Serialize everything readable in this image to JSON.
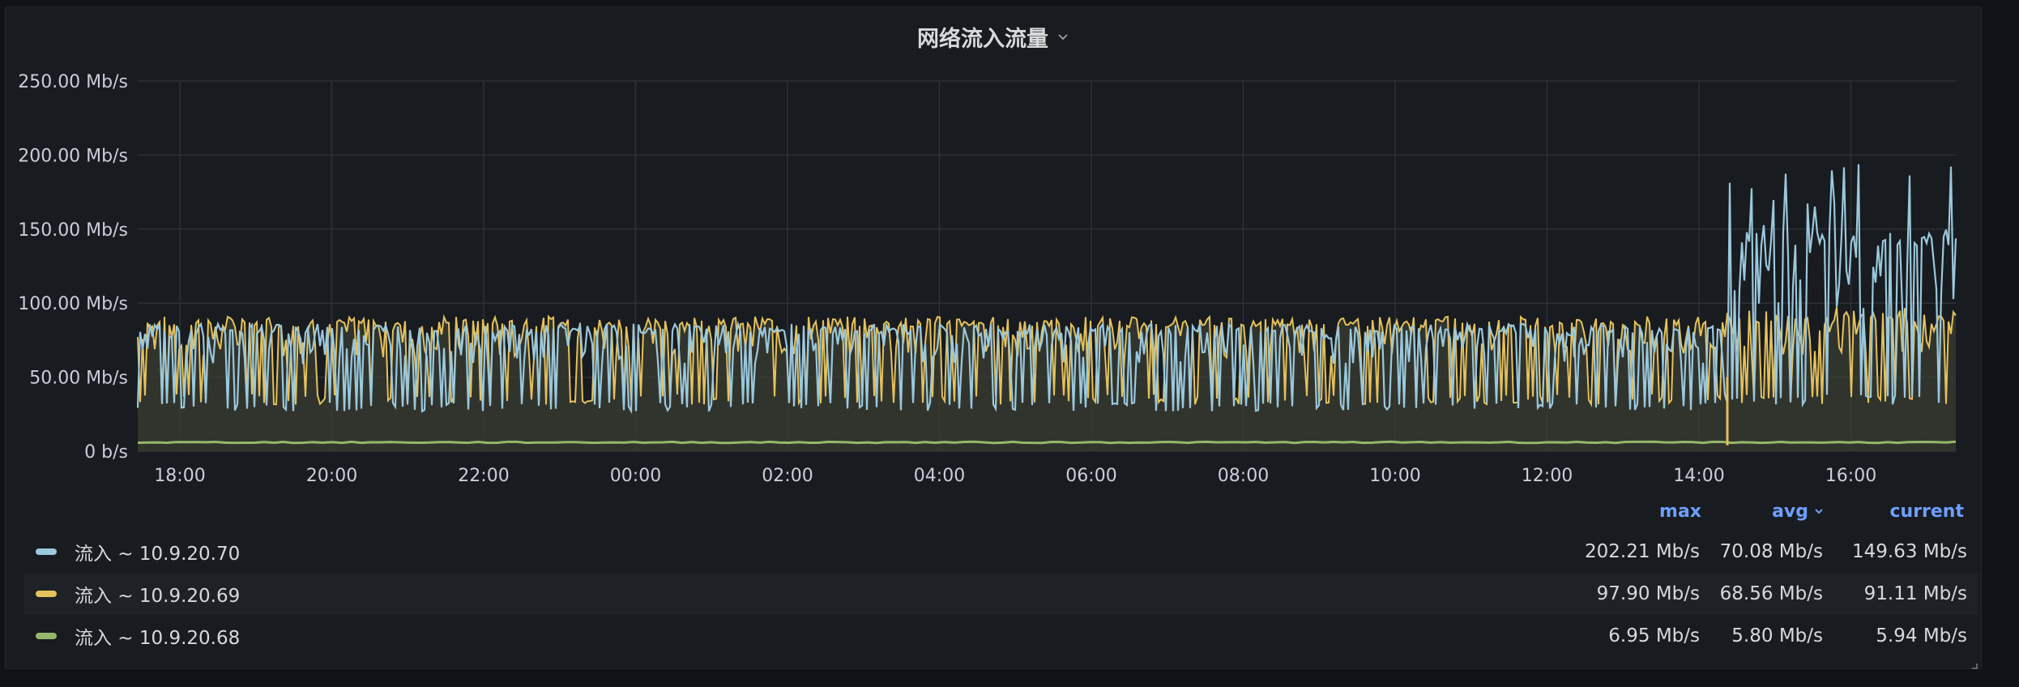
{
  "panel": {
    "title": "网络流入流量"
  },
  "chart_data": {
    "type": "line",
    "title": "网络流入流量",
    "ylabel": "",
    "xlabel": "",
    "ylim": [
      0,
      250
    ],
    "y_unit": "Mb/s",
    "y_ticks": [
      "0 b/s",
      "50.00 Mb/s",
      "100.00 Mb/s",
      "150.00 Mb/s",
      "200.00 Mb/s",
      "250.00 Mb/s"
    ],
    "x_ticks": [
      "18:00",
      "20:00",
      "22:00",
      "00:00",
      "02:00",
      "04:00",
      "06:00",
      "08:00",
      "10:00",
      "12:00",
      "14:00",
      "16:00"
    ],
    "grid": true,
    "legend_placement": "bottom",
    "series": [
      {
        "name": "流入 ~ 10.9.20.70",
        "color": "#9ac8dd",
        "segments": [
          {
            "from": "17:25",
            "to": "14:25",
            "low": 30,
            "high": 88
          },
          {
            "from": "14:25",
            "to": "17:25",
            "low": 35,
            "high": 202
          }
        ]
      },
      {
        "name": "流入 ~ 10.9.20.69",
        "color": "#e5c15c",
        "segments": [
          {
            "from": "17:25",
            "to": "14:25",
            "low": 35,
            "high": 96
          },
          {
            "from": "14:25",
            "to": "17:25",
            "low": 35,
            "high": 98
          }
        ]
      },
      {
        "name": "流入 ~ 10.9.20.68",
        "color": "#96b76b",
        "segments": [
          {
            "from": "17:25",
            "to": "17:25",
            "low": 5.6,
            "high": 6.95
          }
        ]
      }
    ]
  },
  "legend": {
    "headers": {
      "max": "max",
      "avg": "avg",
      "current": "current"
    },
    "rows": [
      {
        "name": "流入 ~ 10.9.20.70",
        "color": "#9ac8dd",
        "max": "202.21 Mb/s",
        "avg": "70.08 Mb/s",
        "current": "149.63 Mb/s"
      },
      {
        "name": "流入 ~ 10.9.20.69",
        "color": "#e5c15c",
        "max": "97.90 Mb/s",
        "avg": "68.56 Mb/s",
        "current": "91.11 Mb/s"
      },
      {
        "name": "流入 ~ 10.9.20.68",
        "color": "#96b76b",
        "max": "6.95 Mb/s",
        "avg": "5.80 Mb/s",
        "current": "5.94 Mb/s"
      }
    ]
  }
}
